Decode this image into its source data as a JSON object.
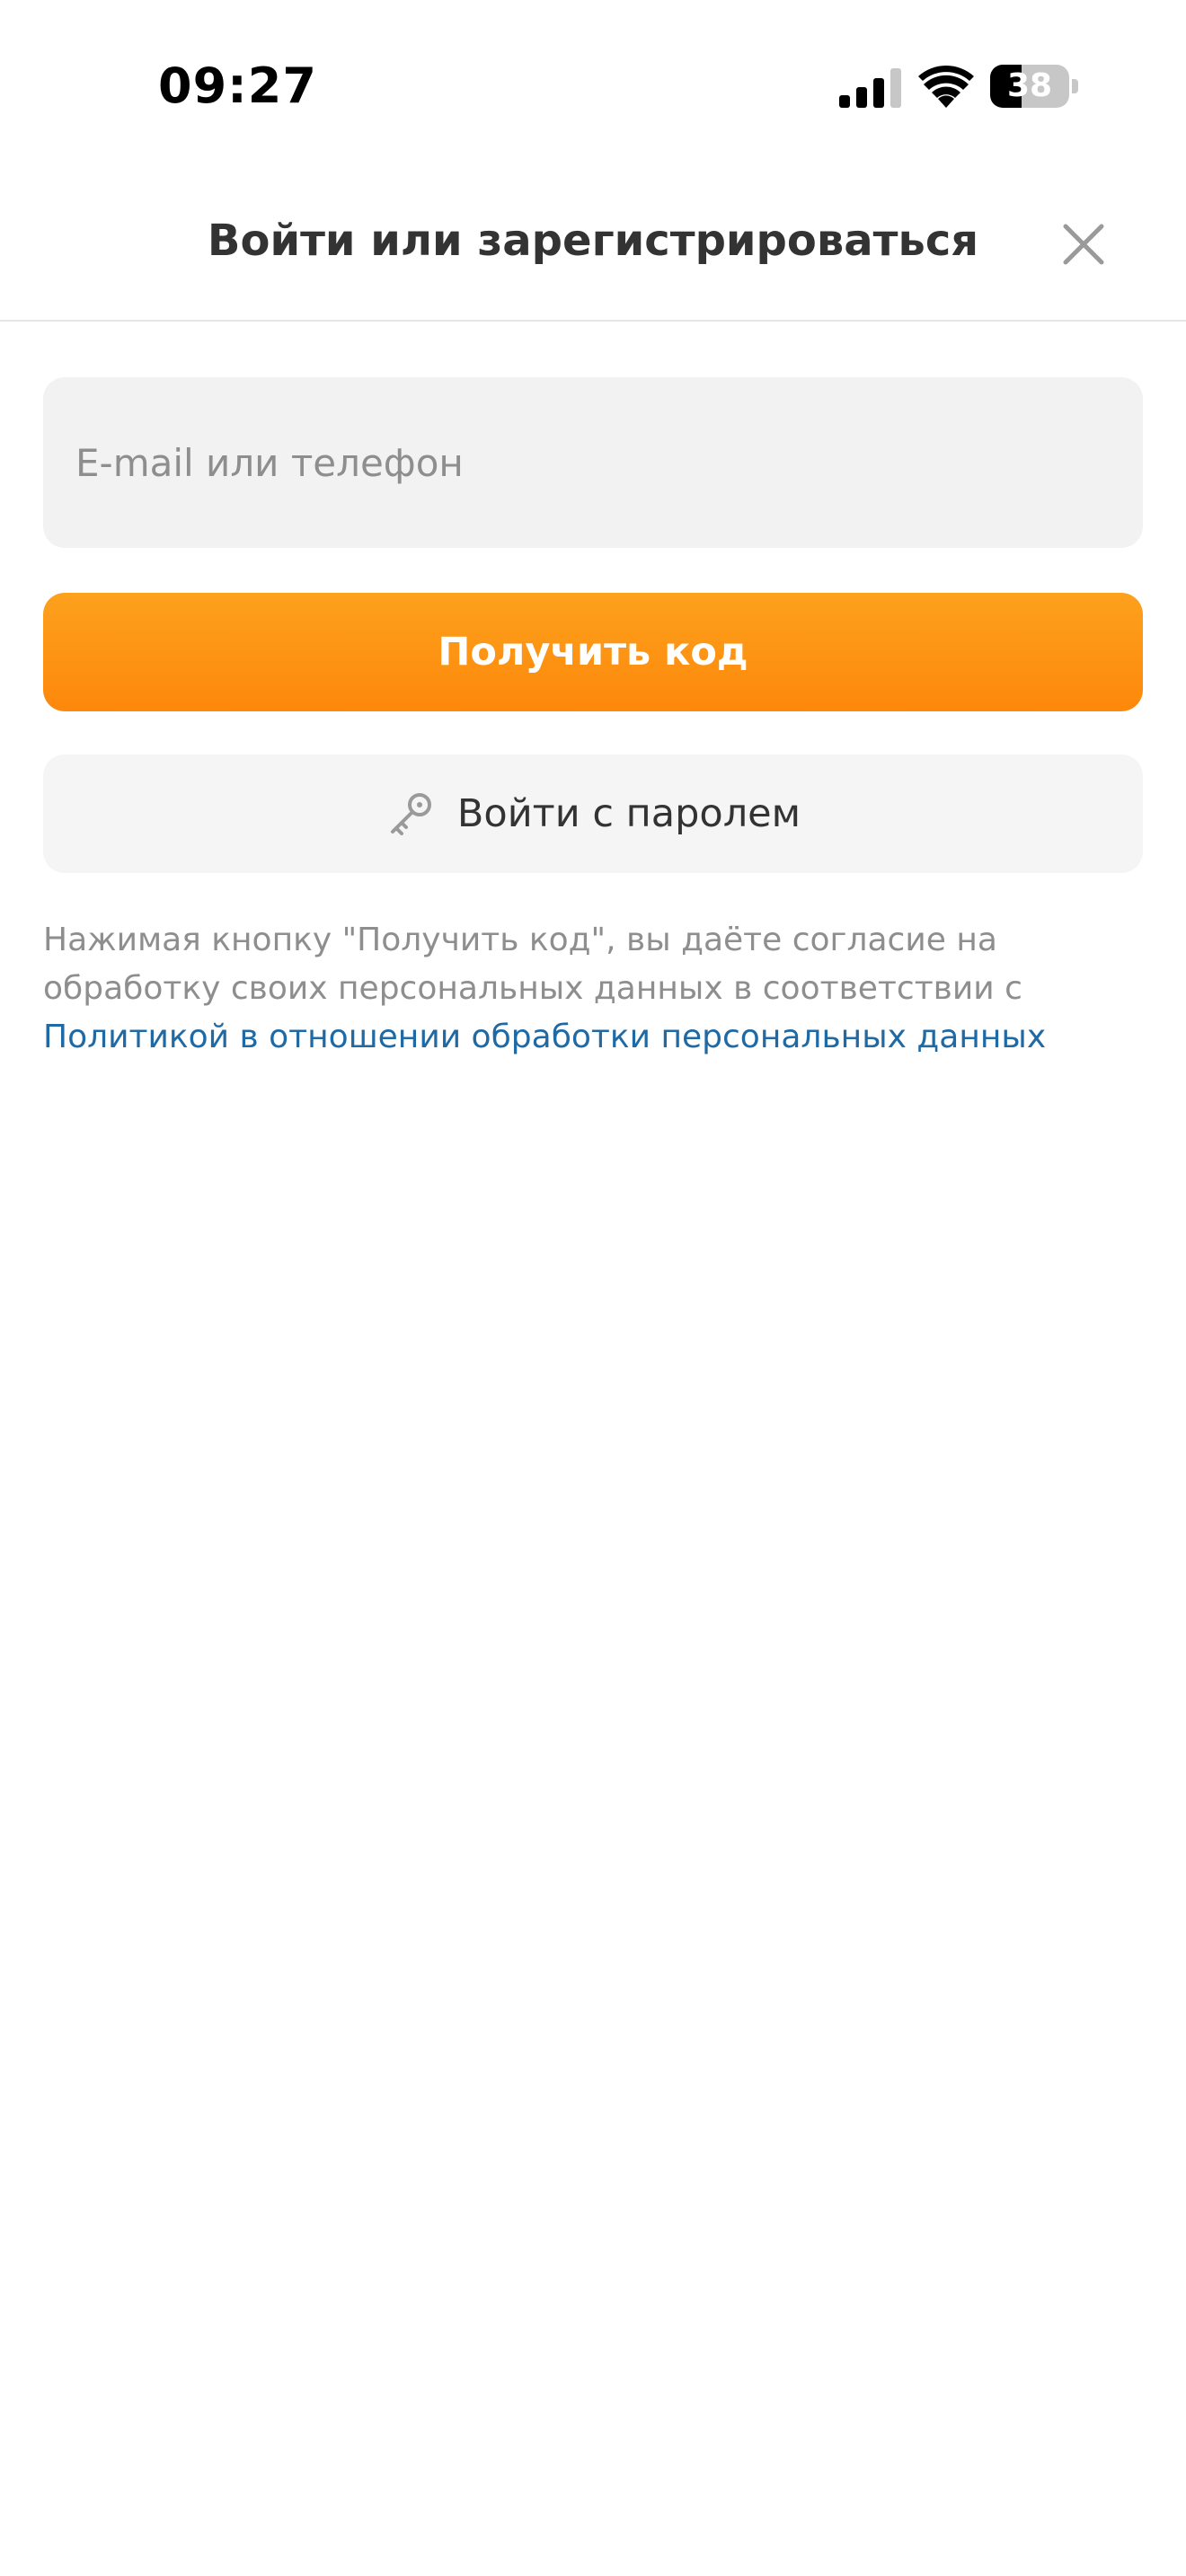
{
  "status_bar": {
    "time": "09:27",
    "battery_level": "38",
    "icons": [
      "cellular-signal-icon",
      "wifi-icon",
      "battery-icon"
    ]
  },
  "header": {
    "title": "Войти или зарегистрироваться",
    "close_icon": "close-icon"
  },
  "form": {
    "input_placeholder": "E-mail или телефон",
    "input_value": "",
    "get_code_label": "Получить код",
    "password_login_label": "Войти с паролем",
    "password_login_icon": "key-icon"
  },
  "consent": {
    "text": "Нажимая кнопку \"Получить код\",  вы даёте согласие на обработку своих персональных данных в соответствии с ",
    "link_text": "Политикой в отношении обработки персональных данных"
  },
  "colors": {
    "accent_orange": "#fd940f",
    "link_blue": "#1f6aa5",
    "muted_text": "#8e8e8e",
    "input_background": "#f2f2f2"
  }
}
